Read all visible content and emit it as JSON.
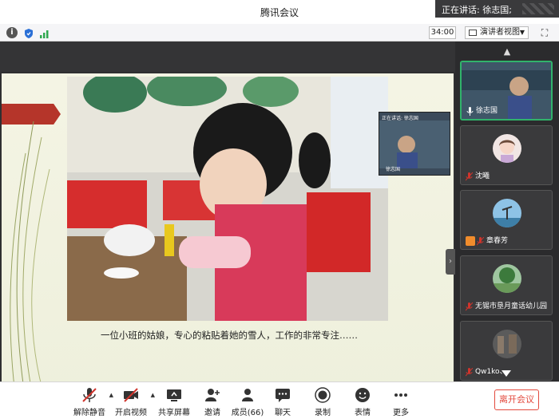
{
  "window": {
    "title": "腾讯会议"
  },
  "speaking": {
    "text": "正在讲话: 徐志国;"
  },
  "infobar": {
    "timer": "34:00",
    "view_mode": "演讲者视图"
  },
  "share": {
    "caption": "一位小班的姑娘，专心的粘贴着她的雪人，工作的非常专注……",
    "pip_label": "正在讲话: 徐志国",
    "pip_name": "徐志国"
  },
  "participants": [
    {
      "name": "徐志国",
      "muted": false,
      "active": true,
      "icon": "mic-on-icon"
    },
    {
      "name": "沈曦",
      "muted": true,
      "active": false,
      "icon": "mic-off-icon"
    },
    {
      "name": "章春芳",
      "muted": true,
      "active": false,
      "icon": "mic-off-icon",
      "badge": "host-icon"
    },
    {
      "name": "无锡市垦月童话幼儿园",
      "muted": true,
      "active": false,
      "icon": "mic-off-icon"
    },
    {
      "name": "Qw1ko、",
      "muted": true,
      "active": false,
      "icon": "mic-off-icon"
    }
  ],
  "toolbar": {
    "unmute": "解除静音",
    "video": "开启视频",
    "share": "共享屏幕",
    "invite": "邀请",
    "members": "成员(66)",
    "chat": "聊天",
    "record": "录制",
    "emoji": "表情",
    "more": "更多",
    "leave": "离开会议"
  },
  "colors": {
    "accent_green": "#31b36b",
    "leave_red": "#e34a3e",
    "muted_red": "#d0342c"
  }
}
